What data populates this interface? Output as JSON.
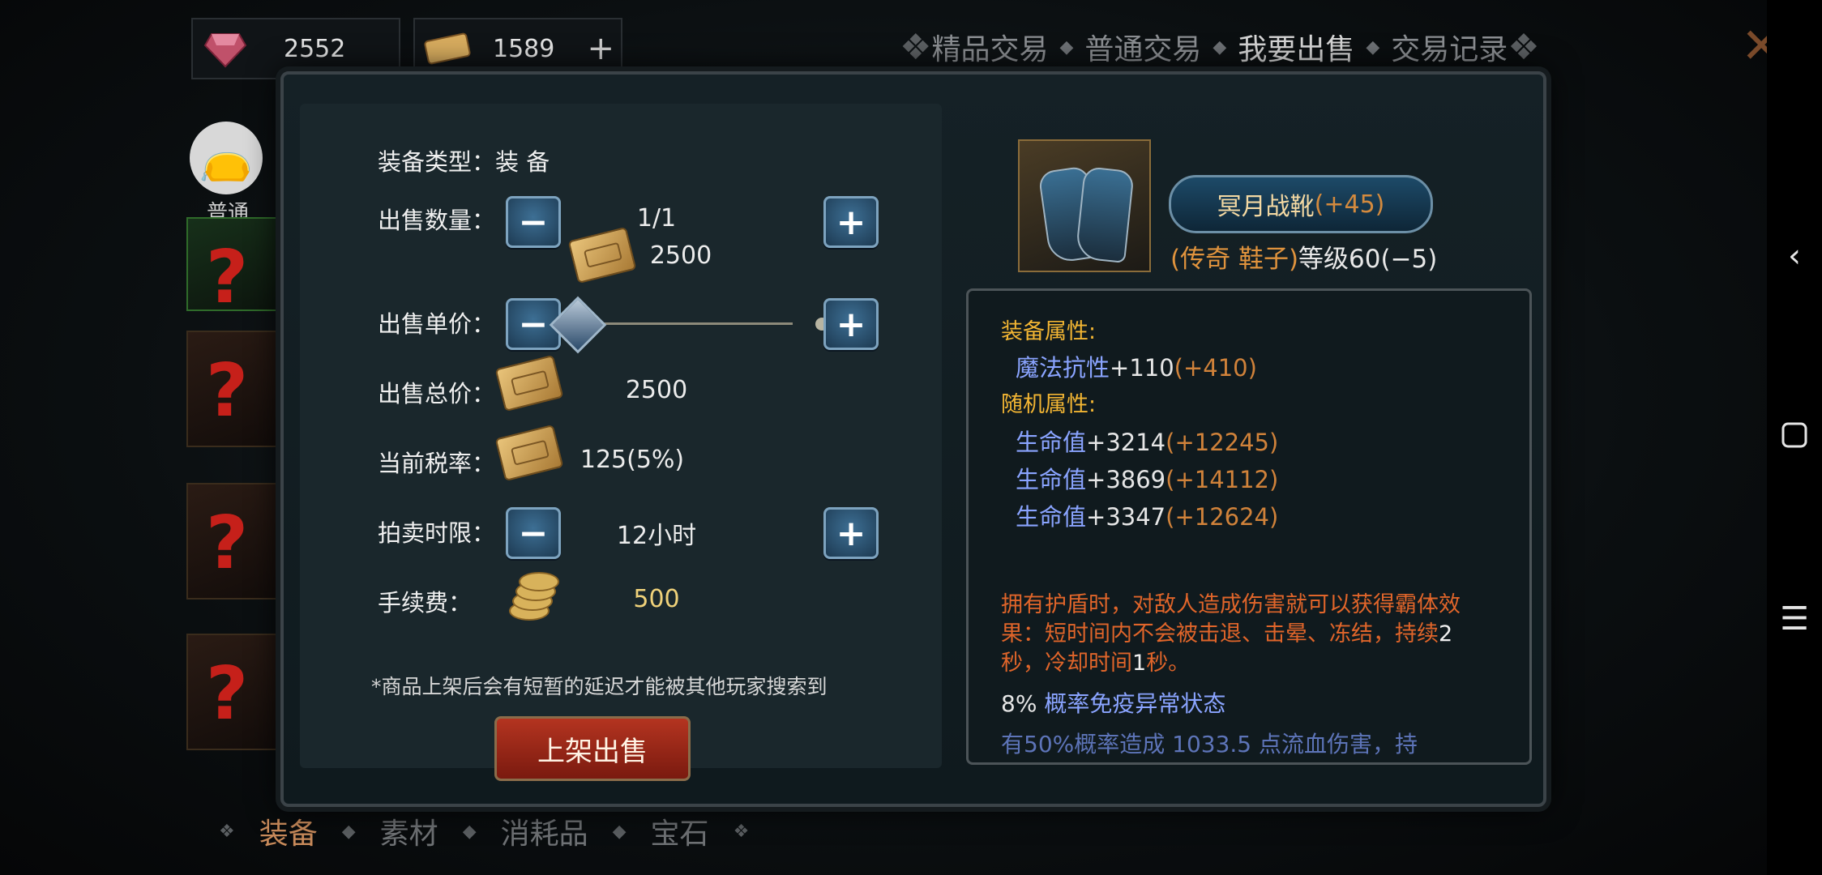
{
  "currency": [
    {
      "icon": "ruby-gem-icon",
      "value": "2552"
    },
    {
      "icon": "gold-ticket-icon",
      "value": "1589",
      "add": "+"
    }
  ],
  "top_tabs": [
    {
      "label": "精品交易",
      "active": false
    },
    {
      "label": "普通交易",
      "active": false
    },
    {
      "label": "我要出售",
      "active": true
    },
    {
      "label": "交易记录",
      "active": false
    }
  ],
  "side": {
    "category_label": "普通"
  },
  "bottom_tabs": [
    {
      "label": "装备",
      "active": true
    },
    {
      "label": "素材",
      "active": false
    },
    {
      "label": "消耗品",
      "active": false
    },
    {
      "label": "宝石",
      "active": false
    }
  ],
  "sell_form": {
    "type_label": "装备类型：",
    "type_value": "装 备",
    "qty_label": "出售数量：",
    "qty_value": "1/1",
    "ref_price": "2500",
    "unit_label": "出售单价：",
    "total_label": "出售总价：",
    "total_value": "2500",
    "tax_label": "当前税率：",
    "tax_value": "125(5%)",
    "time_label": "拍卖时限：",
    "time_value": "12小时",
    "fee_label": "手续费：",
    "fee_value": "500",
    "note": "*商品上架后会有短暂的延迟才能被其他玩家搜索到",
    "submit_label": "上架出售"
  },
  "item": {
    "name": "冥月战靴",
    "name_bonus": "(+45)",
    "rarity": "(传奇 鞋子)",
    "level": "等级60(−5)",
    "equip_header": "装备属性:",
    "equip_attrs": [
      {
        "key": "魔法抗性",
        "val": "+110",
        "bonus": "(+410)"
      }
    ],
    "random_header": "随机属性:",
    "random_attrs": [
      {
        "key": "生命值",
        "val": "+3214",
        "bonus": "(+12245)"
      },
      {
        "key": "生命值",
        "val": "+3869",
        "bonus": "(+14112)"
      },
      {
        "key": "生命值",
        "val": "+3347",
        "bonus": "(+12624)"
      }
    ],
    "desc_a": "拥有护盾时，对敌人造成伤害就可以获得霸体效果：短时间内不会被击退、击晕、冻结，持续",
    "desc_n1": "2",
    "desc_b": "秒，冷却时间",
    "desc_n2": "1",
    "desc_c": "秒。",
    "immune_pct": "8%",
    "immune_text": "概率免疫异常状态",
    "cut_line": "有50%概率造成 1033.5 点流血伤害，持"
  },
  "colors": {
    "accent_gold": "#f2b533",
    "bonus_orange": "#d0823a",
    "attr_blue": "#8aa4ff",
    "desc_orange": "#e0652a"
  }
}
